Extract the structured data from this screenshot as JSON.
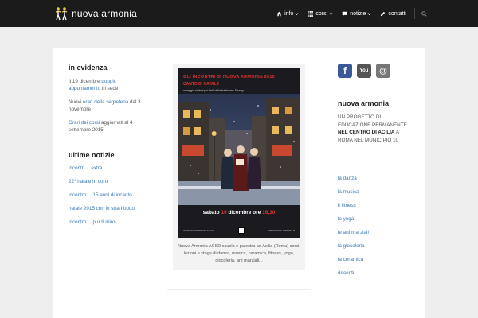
{
  "header": {
    "site_name": "nuova armonia",
    "nav": [
      {
        "label": "info",
        "icon": "home-icon",
        "has_dropdown": true
      },
      {
        "label": "corsi",
        "icon": "grid-icon",
        "has_dropdown": true
      },
      {
        "label": "notizie",
        "icon": "comment-icon",
        "has_dropdown": true
      },
      {
        "label": "contatti",
        "icon": "pencil-icon",
        "has_dropdown": false
      }
    ]
  },
  "evidenza": {
    "title": "in evidenza",
    "items": [
      {
        "pre": "Il 19 dicembre ",
        "link": "doppio appuntamento",
        "post": " in sede"
      },
      {
        "pre": "Nuovi ",
        "link": "orari della segreteria",
        "post": " dal 3 novembre"
      },
      {
        "pre": "",
        "link": "Orari dei corsi",
        "post": " aggiornati al 4 settembre 2015"
      }
    ]
  },
  "news": {
    "title": "ultime notizie",
    "items": [
      "incontri… extra",
      "22° natale in coro",
      "incontro… 15 anni di incanto",
      "natale 2015 con lo strambotto",
      "incontro… pur ti miro"
    ]
  },
  "poster": {
    "title": "GLI INCONTRI DI NUOVA ARMONIA 2015",
    "subtitle": "CANTO DI NATALE",
    "tagline": "omaggio ai temi più belli della tradizione Disney",
    "date_pre": "sabato ",
    "date_day": "19",
    "date_post": " dicembre ore ",
    "date_time": "16,30",
    "footer_left": "INGRESSO RISERVATO AI SOCI",
    "footer_right": "WWW.NUOVA-ARMONIA.IT"
  },
  "caption": "Nuova Armonia ACSD scuola e palestra ad Acilia (Roma) corsi, lezioni e stage di danza, musica, ceramica, fitness, yoga, giocoleria, arti marziali...",
  "right": {
    "social": [
      {
        "name": "facebook-icon",
        "color": "#3b5998",
        "glyph": "f"
      },
      {
        "name": "youtube-icon",
        "color": "#555555",
        "glyph": "You"
      },
      {
        "name": "email-icon",
        "color": "#777777",
        "glyph": "@"
      }
    ],
    "title": "nuova armonia",
    "text_pre": "UN PROGETTO DI EDUCAZIONE PERMANENTE ",
    "text_bold": "NEL CENTRO DI ACILIA",
    "text_post": " A ROMA NEL MUNICIPIO 10",
    "categories": [
      "la danza",
      "la musica",
      "il fitness",
      "lo yoga",
      "le arti marziali",
      "la giocoleria",
      "la ceramica",
      "docenti"
    ]
  }
}
